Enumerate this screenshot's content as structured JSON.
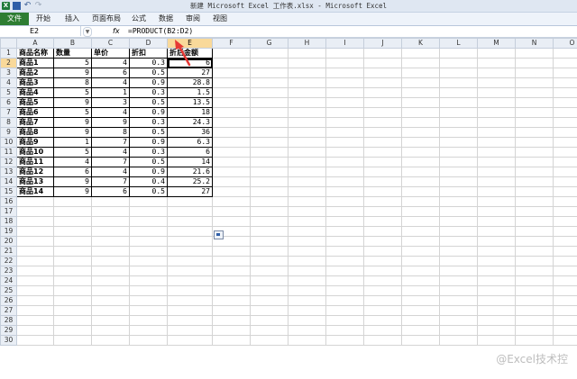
{
  "window": {
    "title": "新建 Microsoft Excel 工作表.xlsx - Microsoft Excel"
  },
  "qat": {
    "logo": "X",
    "undo": "↶",
    "redo": "↷"
  },
  "ribbon": {
    "tabs": [
      "文件",
      "开始",
      "插入",
      "页面布局",
      "公式",
      "数据",
      "审阅",
      "视图"
    ]
  },
  "formula_bar": {
    "name_box": "E2",
    "fx": "fx",
    "formula": "=PRODUCT(B2:D2)"
  },
  "grid": {
    "columns": [
      "A",
      "B",
      "C",
      "D",
      "E",
      "F",
      "G",
      "H",
      "I",
      "J",
      "K",
      "L",
      "M",
      "N",
      "O"
    ],
    "headers": [
      "商品名称",
      "数量",
      "单价",
      "折扣",
      "折后金额"
    ],
    "rows": [
      [
        "商品1",
        "5",
        "4",
        "0.3",
        "6"
      ],
      [
        "商品2",
        "9",
        "6",
        "0.5",
        "27"
      ],
      [
        "商品3",
        "8",
        "4",
        "0.9",
        "28.8"
      ],
      [
        "商品4",
        "5",
        "1",
        "0.3",
        "1.5"
      ],
      [
        "商品5",
        "9",
        "3",
        "0.5",
        "13.5"
      ],
      [
        "商品6",
        "5",
        "4",
        "0.9",
        "18"
      ],
      [
        "商品7",
        "9",
        "9",
        "0.3",
        "24.3"
      ],
      [
        "商品8",
        "9",
        "8",
        "0.5",
        "36"
      ],
      [
        "商品9",
        "1",
        "7",
        "0.9",
        "6.3"
      ],
      [
        "商品10",
        "5",
        "4",
        "0.3",
        "6"
      ],
      [
        "商品11",
        "4",
        "7",
        "0.5",
        "14"
      ],
      [
        "商品12",
        "6",
        "4",
        "0.9",
        "21.6"
      ],
      [
        "商品13",
        "9",
        "7",
        "0.4",
        "25.2"
      ],
      [
        "商品14",
        "9",
        "6",
        "0.5",
        "27"
      ]
    ],
    "total_rows": 30,
    "selected_cell": "E2"
  },
  "watermark": "@Excel技术控",
  "colors": {
    "accent": "#2e7d32",
    "selection": "#f9d99a",
    "arrow": "#e53935"
  }
}
